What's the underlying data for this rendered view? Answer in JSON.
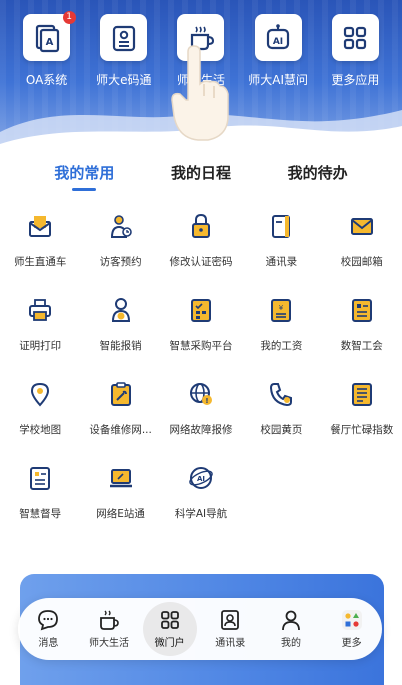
{
  "top_apps": [
    {
      "label": "OA系统",
      "badge": "1",
      "icon": "oa-icon"
    },
    {
      "label": "师大e码通",
      "icon": "id-card-icon"
    },
    {
      "label": "师大生活",
      "icon": "coffee-cup-icon"
    },
    {
      "label": "师大AI慧问",
      "icon": "ai-robot-icon"
    },
    {
      "label": "更多应用",
      "icon": "grid-icon"
    }
  ],
  "tabs": [
    {
      "label": "我的常用",
      "active": true
    },
    {
      "label": "我的日程"
    },
    {
      "label": "我的待办"
    }
  ],
  "apps": [
    {
      "label": "师生直通车",
      "icon": "mail-letter-icon"
    },
    {
      "label": "访客预约",
      "icon": "visitor-icon"
    },
    {
      "label": "修改认证密码",
      "icon": "lock-icon"
    },
    {
      "label": "通讯录",
      "icon": "address-book-icon"
    },
    {
      "label": "校园邮箱",
      "icon": "envelope-icon"
    },
    {
      "label": "证明打印",
      "icon": "printer-icon"
    },
    {
      "label": "智能报销",
      "icon": "reimburse-robot-icon"
    },
    {
      "label": "智慧采购平台",
      "icon": "purchase-icon"
    },
    {
      "label": "我的工资",
      "icon": "salary-icon"
    },
    {
      "label": "数智工会",
      "icon": "union-icon"
    },
    {
      "label": "学校地图",
      "icon": "map-pin-icon"
    },
    {
      "label": "设备维修网...",
      "icon": "repair-clipboard-icon"
    },
    {
      "label": "网络故障报修",
      "icon": "globe-warning-icon"
    },
    {
      "label": "校园黄页",
      "icon": "phone-icon"
    },
    {
      "label": "餐厅忙碌指数",
      "icon": "restaurant-list-icon"
    },
    {
      "label": "智慧督导",
      "icon": "supervise-doc-icon"
    },
    {
      "label": "网络E站通",
      "icon": "laptop-icon"
    },
    {
      "label": "科学AI导航",
      "icon": "ai-orbit-icon"
    }
  ],
  "nav": [
    {
      "label": "消息",
      "icon": "message-icon"
    },
    {
      "label": "师大生活",
      "icon": "coffee-cup-icon"
    },
    {
      "label": "微门户",
      "icon": "grid-icon",
      "active": true
    },
    {
      "label": "通讯录",
      "icon": "contact-icon"
    },
    {
      "label": "我的",
      "icon": "person-icon"
    },
    {
      "label": "更多",
      "icon": "more-apps-icon"
    }
  ],
  "colors": {
    "accent": "#2f6fd8",
    "icon_dark": "#1f3b75",
    "icon_yellow": "#f5b82e"
  }
}
